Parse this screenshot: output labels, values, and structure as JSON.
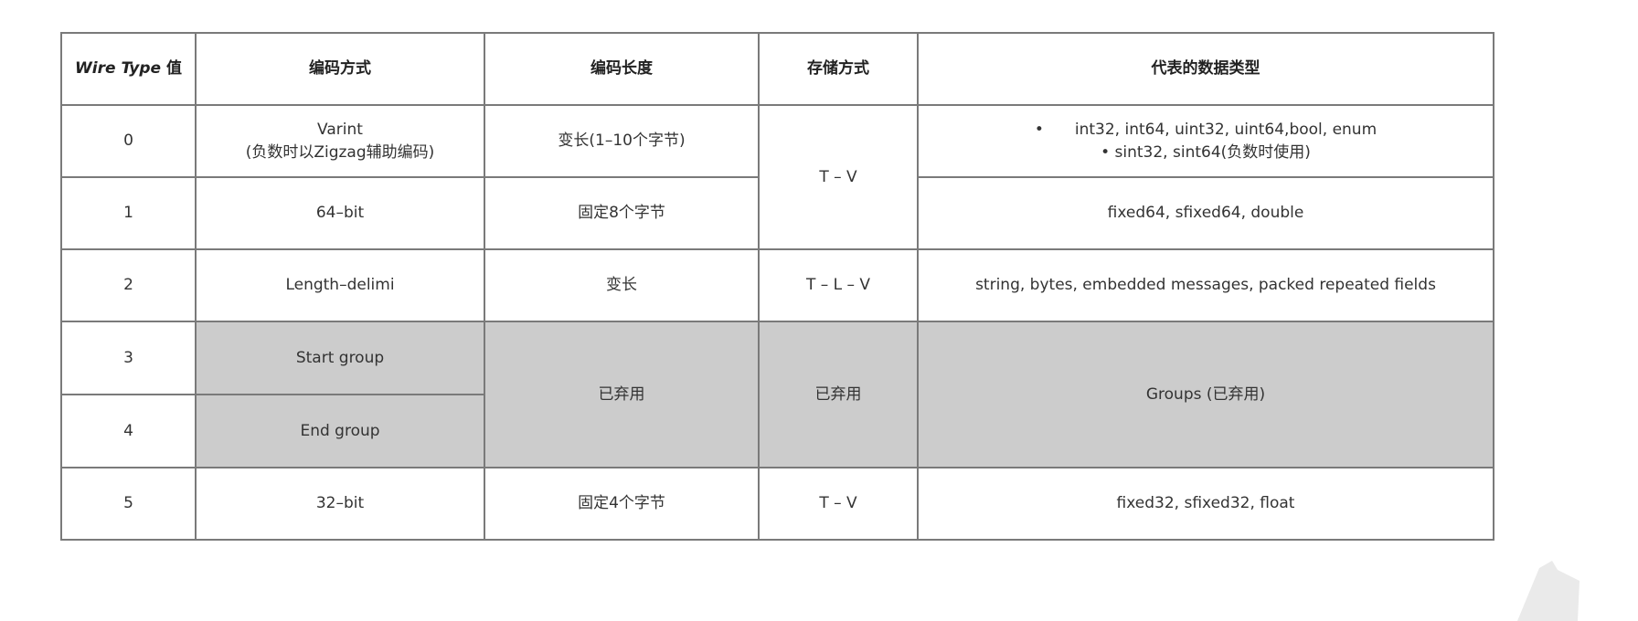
{
  "table": {
    "headers": {
      "wire_type_italic": "Wire Type",
      "wire_type_suffix": " 值",
      "encoding": "编码方式",
      "length": "编码长度",
      "storage": "存储方式",
      "types": "代表的数据类型"
    },
    "rows": [
      {
        "id": "0",
        "encoding_line1": "Varint",
        "encoding_line2": "(负数时以Zigzag辅助编码)",
        "length": "变长(1–10个字节)",
        "storage": "T – V",
        "types_line1_bullet": "•",
        "types_line1": "int32, int64, uint32, uint64,bool, enum",
        "types_line2": "• sint32, sint64(负数时使用)"
      },
      {
        "id": "1",
        "encoding": "64–bit",
        "length": "固定8个字节",
        "types": "fixed64, sfixed64, double"
      },
      {
        "id": "2",
        "encoding": "Length–delimi",
        "length": "变长",
        "storage": "T – L – V",
        "types": "string, bytes, embedded messages, packed repeated fields"
      },
      {
        "id": "3",
        "encoding": "Start group",
        "length": "已弃用",
        "storage": "已弃用",
        "types": "Groups (已弃用)"
      },
      {
        "id": "4",
        "encoding": "End group"
      },
      {
        "id": "5",
        "encoding": "32–bit",
        "length": "固定4个字节",
        "storage": "T – V",
        "types": "fixed32, sfixed32, float"
      }
    ],
    "colors": {
      "border": "#7a7a7a",
      "deprecated_bg": "#cccccc",
      "text": "#333333"
    }
  },
  "watermark": {
    "icon": "watermark-logo-icon"
  }
}
